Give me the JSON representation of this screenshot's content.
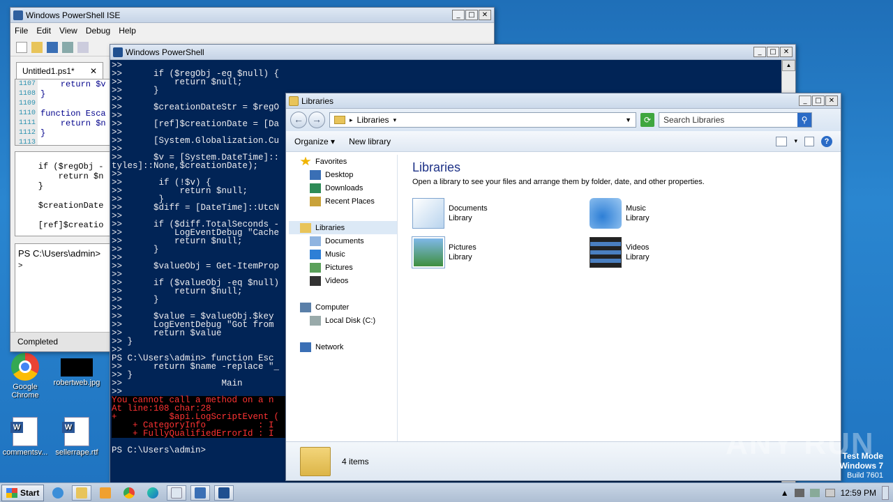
{
  "desktop": {
    "icons": [
      {
        "label": "Google Chrome",
        "icon": "chrome-icon"
      },
      {
        "label": "robertweb.jpg",
        "icon": "image-icon"
      },
      {
        "label": "commentsv...",
        "icon": "word-doc-icon"
      },
      {
        "label": "sellerrape.rtf",
        "icon": "word-doc-icon"
      }
    ]
  },
  "ise": {
    "title": "Windows PowerShell ISE",
    "menu": [
      "File",
      "Edit",
      "View",
      "Debug",
      "Help"
    ],
    "tab": "Untitled1.ps1*",
    "tab_close": "✕",
    "editor_lines": [
      {
        "num": "1107",
        "code": "    return $v"
      },
      {
        "num": "1108",
        "code": "}"
      },
      {
        "num": "1109",
        "code": ""
      },
      {
        "num": "1110",
        "code": "function Esca"
      },
      {
        "num": "1111",
        "code": "    return $n"
      },
      {
        "num": "1112",
        "code": "}"
      },
      {
        "num": "1113",
        "code": ""
      }
    ],
    "script_text": "    if ($regObj -\n        return $n\n    }\n\n    $creationDate\n\n    [ref]$creatio",
    "console_prompt": "PS C:\\Users\\admin>",
    "console_caret": ">",
    "status": "Completed"
  },
  "ps": {
    "title": "Windows PowerShell",
    "lines": [
      ">>",
      ">>      if ($regObj -eq $null) {",
      ">>          return $null;",
      ">>      }",
      ">>",
      ">>      $creationDateStr = $regO",
      ">>",
      ">>      [ref]$creationDate = [Da",
      ">>",
      ">>      [System.Globalization.Cu",
      ">>",
      ">>      $v = [System.DateTime]::",
      "tyles]::None,$creationDate);",
      ">>",
      ">>       if (!$v) {",
      ">>           return $null;",
      ">>       }",
      ">>      $diff = [DateTime]::UtcN",
      ">>",
      ">>      if ($diff.TotalSeconds -",
      ">>          LogEventDebug \"Cache",
      ">>          return $null;",
      ">>      }",
      ">>",
      ">>      $valueObj = Get-ItemProp",
      ">>",
      ">>      if ($valueObj -eq $null)",
      ">>          return $null;",
      ">>      }",
      ">>",
      ">>      $value = $valueObj.$key",
      ">>      LogEventDebug \"Got from",
      ">>      return $value",
      ">> }",
      ">>",
      "PS C:\\Users\\admin> function Esc",
      ">>      return $name -replace \"_",
      ">> }",
      ">>                   Main",
      ">>"
    ],
    "error_lines": [
      "You cannot call a method on a n",
      "At line:108 char:28",
      "+          $api.LogScriptEvent (",
      "    + CategoryInfo          : I",
      "    + FullyQualifiedErrorId : I"
    ],
    "final_prompt": "PS C:\\Users\\admin>"
  },
  "libraries": {
    "title": "Libraries",
    "address": "Libraries",
    "search_placeholder": "Search Libraries",
    "toolbar": {
      "organize": "Organize",
      "new_library": "New library"
    },
    "nav": [
      {
        "label": "Favorites",
        "indent": 0,
        "icon": "star-icon"
      },
      {
        "label": "Desktop",
        "indent": 1,
        "icon": "desktop-icon"
      },
      {
        "label": "Downloads",
        "indent": 1,
        "icon": "downloads-icon"
      },
      {
        "label": "Recent Places",
        "indent": 1,
        "icon": "recent-places-icon"
      },
      {
        "label": "",
        "indent": 0,
        "icon": ""
      },
      {
        "label": "Libraries",
        "indent": 0,
        "icon": "libraries-icon",
        "selected": true
      },
      {
        "label": "Documents",
        "indent": 1,
        "icon": "documents-icon"
      },
      {
        "label": "Music",
        "indent": 1,
        "icon": "music-icon"
      },
      {
        "label": "Pictures",
        "indent": 1,
        "icon": "pictures-icon"
      },
      {
        "label": "Videos",
        "indent": 1,
        "icon": "videos-icon"
      },
      {
        "label": "",
        "indent": 0,
        "icon": ""
      },
      {
        "label": "Computer",
        "indent": 0,
        "icon": "computer-icon"
      },
      {
        "label": "Local Disk (C:)",
        "indent": 1,
        "icon": "disk-icon"
      },
      {
        "label": "",
        "indent": 0,
        "icon": ""
      },
      {
        "label": "Network",
        "indent": 0,
        "icon": "network-icon"
      }
    ],
    "heading": "Libraries",
    "subheading": "Open a library to see your files and arrange them by folder, date, and other properties.",
    "items": [
      {
        "name": "Documents",
        "type": "Library",
        "icon": "documents-library-icon"
      },
      {
        "name": "Music",
        "type": "Library",
        "icon": "music-library-icon"
      },
      {
        "name": "Pictures",
        "type": "Library",
        "icon": "pictures-library-icon"
      },
      {
        "name": "Videos",
        "type": "Library",
        "icon": "videos-library-icon"
      }
    ],
    "status": "4 items"
  },
  "taskbar": {
    "start": "Start",
    "clock": "12:59 PM"
  },
  "watermark": {
    "line1": "Test Mode",
    "line2": "Windows 7",
    "line3": "Build 7601",
    "brand": "ANY RUN"
  }
}
